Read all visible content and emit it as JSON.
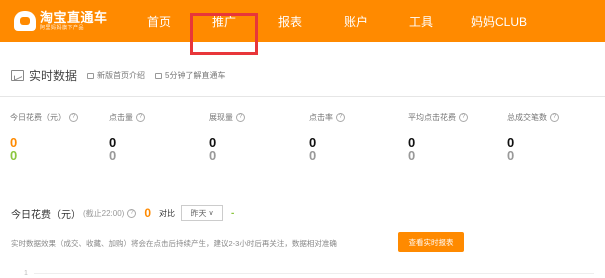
{
  "topbar": {
    "logo_title": "淘宝直通车",
    "logo_sub": "阿里妈妈旗下产品",
    "nav": [
      "首页",
      "推广",
      "报表",
      "账户",
      "工具",
      "妈妈CLUB"
    ]
  },
  "realtime": {
    "title": "实时数据",
    "links": [
      "新版首页介绍",
      "5分钟了解直通车"
    ]
  },
  "metrics": [
    {
      "label": "今日花费（元）",
      "value": "0",
      "compare": "0"
    },
    {
      "label": "点击量",
      "value": "0",
      "compare": "0"
    },
    {
      "label": "展现量",
      "value": "0",
      "compare": "0"
    },
    {
      "label": "点击率",
      "value": "0",
      "compare": "0"
    },
    {
      "label": "平均点击花费",
      "value": "0",
      "compare": "0"
    },
    {
      "label": "总成交笔数",
      "value": "0",
      "compare": "0"
    }
  ],
  "spend": {
    "title": "今日花费（元）",
    "note": "(截止22:00)",
    "value": "0",
    "compare_label": "对比",
    "compare_option": "昨天",
    "compare_value": "-"
  },
  "notice": "实时数据效果（成交、收藏、加购）将会在点击后持续产生，建议2-3小时后再关注，数据相对准确",
  "report_button": "查看实时报表",
  "axis_tick": "1",
  "colors": {
    "brand": "#ff8a00",
    "highlight": "#e8363a",
    "compare": "#8cc63f"
  }
}
